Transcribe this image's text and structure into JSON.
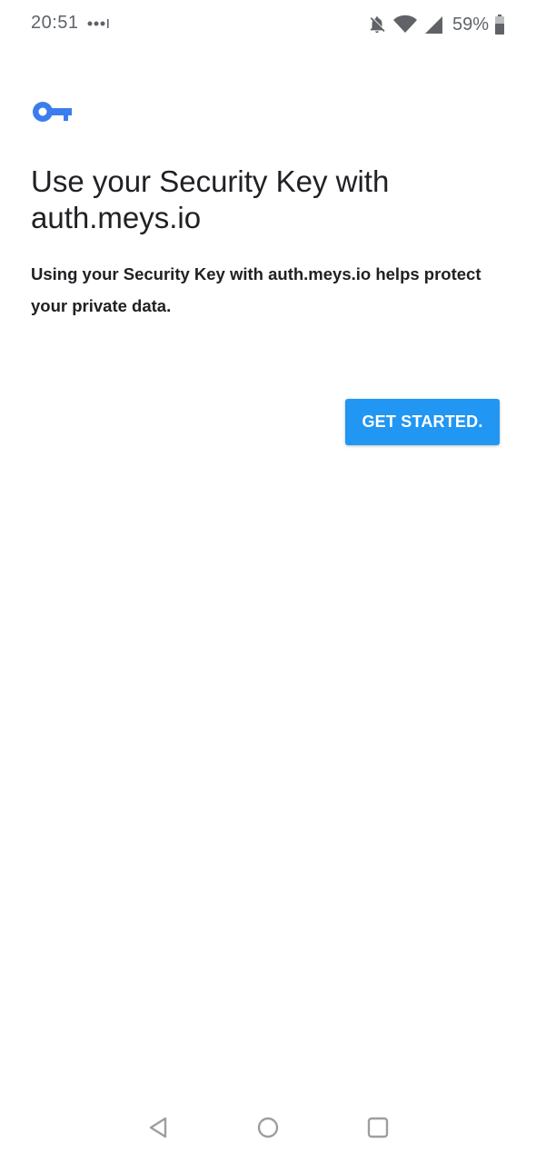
{
  "status_bar": {
    "time": "20:51",
    "battery_percent": "59%",
    "icons": [
      "more-dots-icon",
      "bell-off-icon",
      "wifi-icon",
      "signal-icon",
      "battery-icon"
    ]
  },
  "prompt": {
    "icon": "key-icon",
    "title": "Use your Security Key with auth.meys.io",
    "description": "Using your Security Key with auth.meys.io helps protect your private data.",
    "button_label": "GET STARTED."
  },
  "nav_bar": {
    "icons": [
      "back-icon",
      "home-icon",
      "recents-icon"
    ]
  },
  "colors": {
    "accent": "#2196f3",
    "key_icon": "#3b7ded",
    "text": "#202124",
    "status_icons": "#5f6368",
    "nav_icons": "#9e9e9e"
  }
}
